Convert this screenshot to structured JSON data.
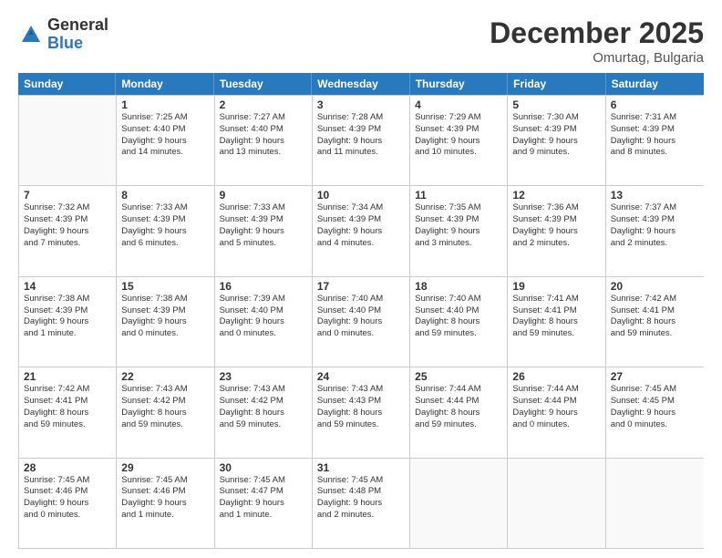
{
  "logo": {
    "general": "General",
    "blue": "Blue"
  },
  "header": {
    "month": "December 2025",
    "location": "Omurtag, Bulgaria"
  },
  "weekdays": [
    "Sunday",
    "Monday",
    "Tuesday",
    "Wednesday",
    "Thursday",
    "Friday",
    "Saturday"
  ],
  "rows": [
    [
      {
        "day": "",
        "text": ""
      },
      {
        "day": "1",
        "text": "Sunrise: 7:25 AM\nSunset: 4:40 PM\nDaylight: 9 hours\nand 14 minutes."
      },
      {
        "day": "2",
        "text": "Sunrise: 7:27 AM\nSunset: 4:40 PM\nDaylight: 9 hours\nand 13 minutes."
      },
      {
        "day": "3",
        "text": "Sunrise: 7:28 AM\nSunset: 4:39 PM\nDaylight: 9 hours\nand 11 minutes."
      },
      {
        "day": "4",
        "text": "Sunrise: 7:29 AM\nSunset: 4:39 PM\nDaylight: 9 hours\nand 10 minutes."
      },
      {
        "day": "5",
        "text": "Sunrise: 7:30 AM\nSunset: 4:39 PM\nDaylight: 9 hours\nand 9 minutes."
      },
      {
        "day": "6",
        "text": "Sunrise: 7:31 AM\nSunset: 4:39 PM\nDaylight: 9 hours\nand 8 minutes."
      }
    ],
    [
      {
        "day": "7",
        "text": "Sunrise: 7:32 AM\nSunset: 4:39 PM\nDaylight: 9 hours\nand 7 minutes."
      },
      {
        "day": "8",
        "text": "Sunrise: 7:33 AM\nSunset: 4:39 PM\nDaylight: 9 hours\nand 6 minutes."
      },
      {
        "day": "9",
        "text": "Sunrise: 7:33 AM\nSunset: 4:39 PM\nDaylight: 9 hours\nand 5 minutes."
      },
      {
        "day": "10",
        "text": "Sunrise: 7:34 AM\nSunset: 4:39 PM\nDaylight: 9 hours\nand 4 minutes."
      },
      {
        "day": "11",
        "text": "Sunrise: 7:35 AM\nSunset: 4:39 PM\nDaylight: 9 hours\nand 3 minutes."
      },
      {
        "day": "12",
        "text": "Sunrise: 7:36 AM\nSunset: 4:39 PM\nDaylight: 9 hours\nand 2 minutes."
      },
      {
        "day": "13",
        "text": "Sunrise: 7:37 AM\nSunset: 4:39 PM\nDaylight: 9 hours\nand 2 minutes."
      }
    ],
    [
      {
        "day": "14",
        "text": "Sunrise: 7:38 AM\nSunset: 4:39 PM\nDaylight: 9 hours\nand 1 minute."
      },
      {
        "day": "15",
        "text": "Sunrise: 7:38 AM\nSunset: 4:39 PM\nDaylight: 9 hours\nand 0 minutes."
      },
      {
        "day": "16",
        "text": "Sunrise: 7:39 AM\nSunset: 4:40 PM\nDaylight: 9 hours\nand 0 minutes."
      },
      {
        "day": "17",
        "text": "Sunrise: 7:40 AM\nSunset: 4:40 PM\nDaylight: 9 hours\nand 0 minutes."
      },
      {
        "day": "18",
        "text": "Sunrise: 7:40 AM\nSunset: 4:40 PM\nDaylight: 8 hours\nand 59 minutes."
      },
      {
        "day": "19",
        "text": "Sunrise: 7:41 AM\nSunset: 4:41 PM\nDaylight: 8 hours\nand 59 minutes."
      },
      {
        "day": "20",
        "text": "Sunrise: 7:42 AM\nSunset: 4:41 PM\nDaylight: 8 hours\nand 59 minutes."
      }
    ],
    [
      {
        "day": "21",
        "text": "Sunrise: 7:42 AM\nSunset: 4:41 PM\nDaylight: 8 hours\nand 59 minutes."
      },
      {
        "day": "22",
        "text": "Sunrise: 7:43 AM\nSunset: 4:42 PM\nDaylight: 8 hours\nand 59 minutes."
      },
      {
        "day": "23",
        "text": "Sunrise: 7:43 AM\nSunset: 4:42 PM\nDaylight: 8 hours\nand 59 minutes."
      },
      {
        "day": "24",
        "text": "Sunrise: 7:43 AM\nSunset: 4:43 PM\nDaylight: 8 hours\nand 59 minutes."
      },
      {
        "day": "25",
        "text": "Sunrise: 7:44 AM\nSunset: 4:44 PM\nDaylight: 8 hours\nand 59 minutes."
      },
      {
        "day": "26",
        "text": "Sunrise: 7:44 AM\nSunset: 4:44 PM\nDaylight: 9 hours\nand 0 minutes."
      },
      {
        "day": "27",
        "text": "Sunrise: 7:45 AM\nSunset: 4:45 PM\nDaylight: 9 hours\nand 0 minutes."
      }
    ],
    [
      {
        "day": "28",
        "text": "Sunrise: 7:45 AM\nSunset: 4:46 PM\nDaylight: 9 hours\nand 0 minutes."
      },
      {
        "day": "29",
        "text": "Sunrise: 7:45 AM\nSunset: 4:46 PM\nDaylight: 9 hours\nand 1 minute."
      },
      {
        "day": "30",
        "text": "Sunrise: 7:45 AM\nSunset: 4:47 PM\nDaylight: 9 hours\nand 1 minute."
      },
      {
        "day": "31",
        "text": "Sunrise: 7:45 AM\nSunset: 4:48 PM\nDaylight: 9 hours\nand 2 minutes."
      },
      {
        "day": "",
        "text": ""
      },
      {
        "day": "",
        "text": ""
      },
      {
        "day": "",
        "text": ""
      }
    ]
  ]
}
